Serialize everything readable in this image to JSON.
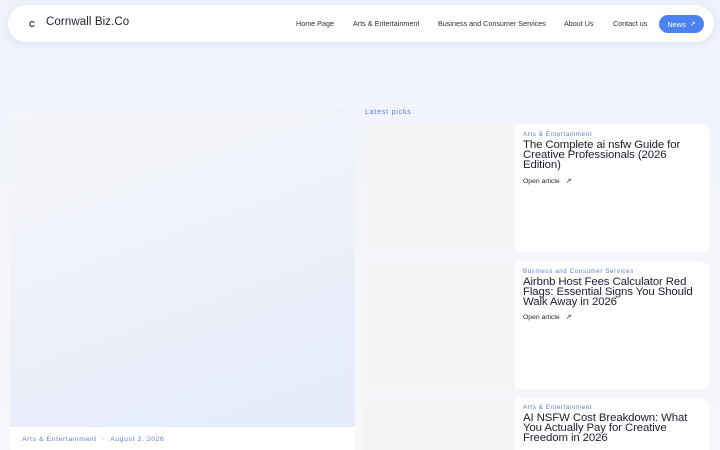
{
  "header": {
    "logo_letter": "C",
    "brand": "Cornwall Biz.Co",
    "nav": [
      "Home Page",
      "Arts & Entertainment",
      "Business and Consumer Services",
      "About Us",
      "Contact us"
    ],
    "cta_label": "News",
    "cta_arrow": "↗"
  },
  "hero": {
    "category": "Arts & Entertainment",
    "separator": "·",
    "date": "August 2, 2026"
  },
  "latest": {
    "label": "Latest picks",
    "cards": [
      {
        "category": "Arts & Entertainment",
        "title": "The Complete ai nsfw Guide for Creative Professionals (2026 Edition)",
        "link": "Open article",
        "arrow": "↗"
      },
      {
        "category": "Business and Consumer Services",
        "title": "Airbnb Host Fees Calculator Red Flags: Essential Signs You Should Walk Away in 2026",
        "link": "Open article",
        "arrow": "↗"
      },
      {
        "category": "Arts & Entertainment",
        "title": "AI NSFW Cost Breakdown: What You Actually Pay for Creative Freedom in 2026",
        "link": "",
        "arrow": ""
      }
    ]
  },
  "colors": {
    "accent": "#4b82f0",
    "category_text": "#5b7fd0"
  }
}
